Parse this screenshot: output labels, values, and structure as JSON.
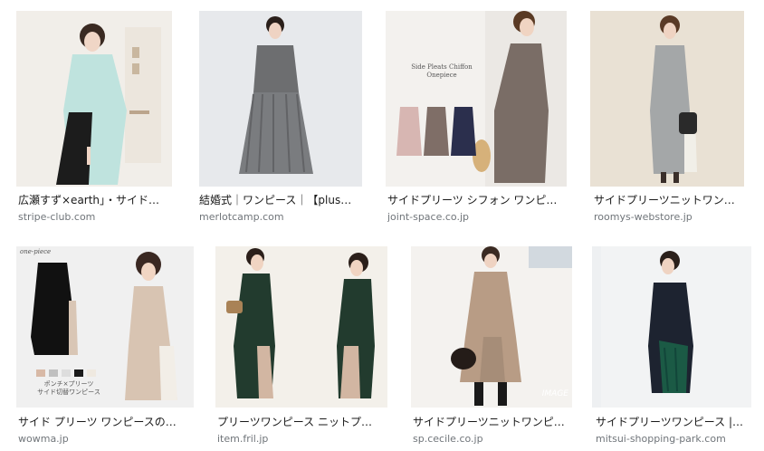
{
  "results": [
    {
      "title": "広瀬すず×earth」・サイド…",
      "source": "stripe-club.com"
    },
    {
      "title": "結婚式｜ワンピース｜【plus…",
      "source": "merlotcamp.com"
    },
    {
      "title": "サイドプリーツ シフォン ワンピ…",
      "source": "joint-space.co.jp",
      "overlay": {
        "line1": "Side Pleats Chiffon",
        "line2": "Onepiece"
      }
    },
    {
      "title": "サイドプリーツニットワン…",
      "source": "roomys-webstore.jp"
    },
    {
      "title": "サイド プリーツ ワンピースの…",
      "source": "wowma.jp",
      "overlay": {
        "line1": "ポンチ×プリーツ",
        "line2": "サイド切替ワンピース",
        "corner": "one-piece"
      }
    },
    {
      "title": "プリーツワンピース ニットプ…",
      "source": "item.fril.jp"
    },
    {
      "title": "サイドプリーツニットワンピ…",
      "source": "sp.cecile.co.jp",
      "overlay": {
        "corner": "IMAGE"
      }
    },
    {
      "title": "サイドプリーツワンピース |…",
      "source": "mitsui-shopping-park.com"
    }
  ],
  "colors": {
    "title": "#1a1a1a",
    "source": "#70757a"
  }
}
